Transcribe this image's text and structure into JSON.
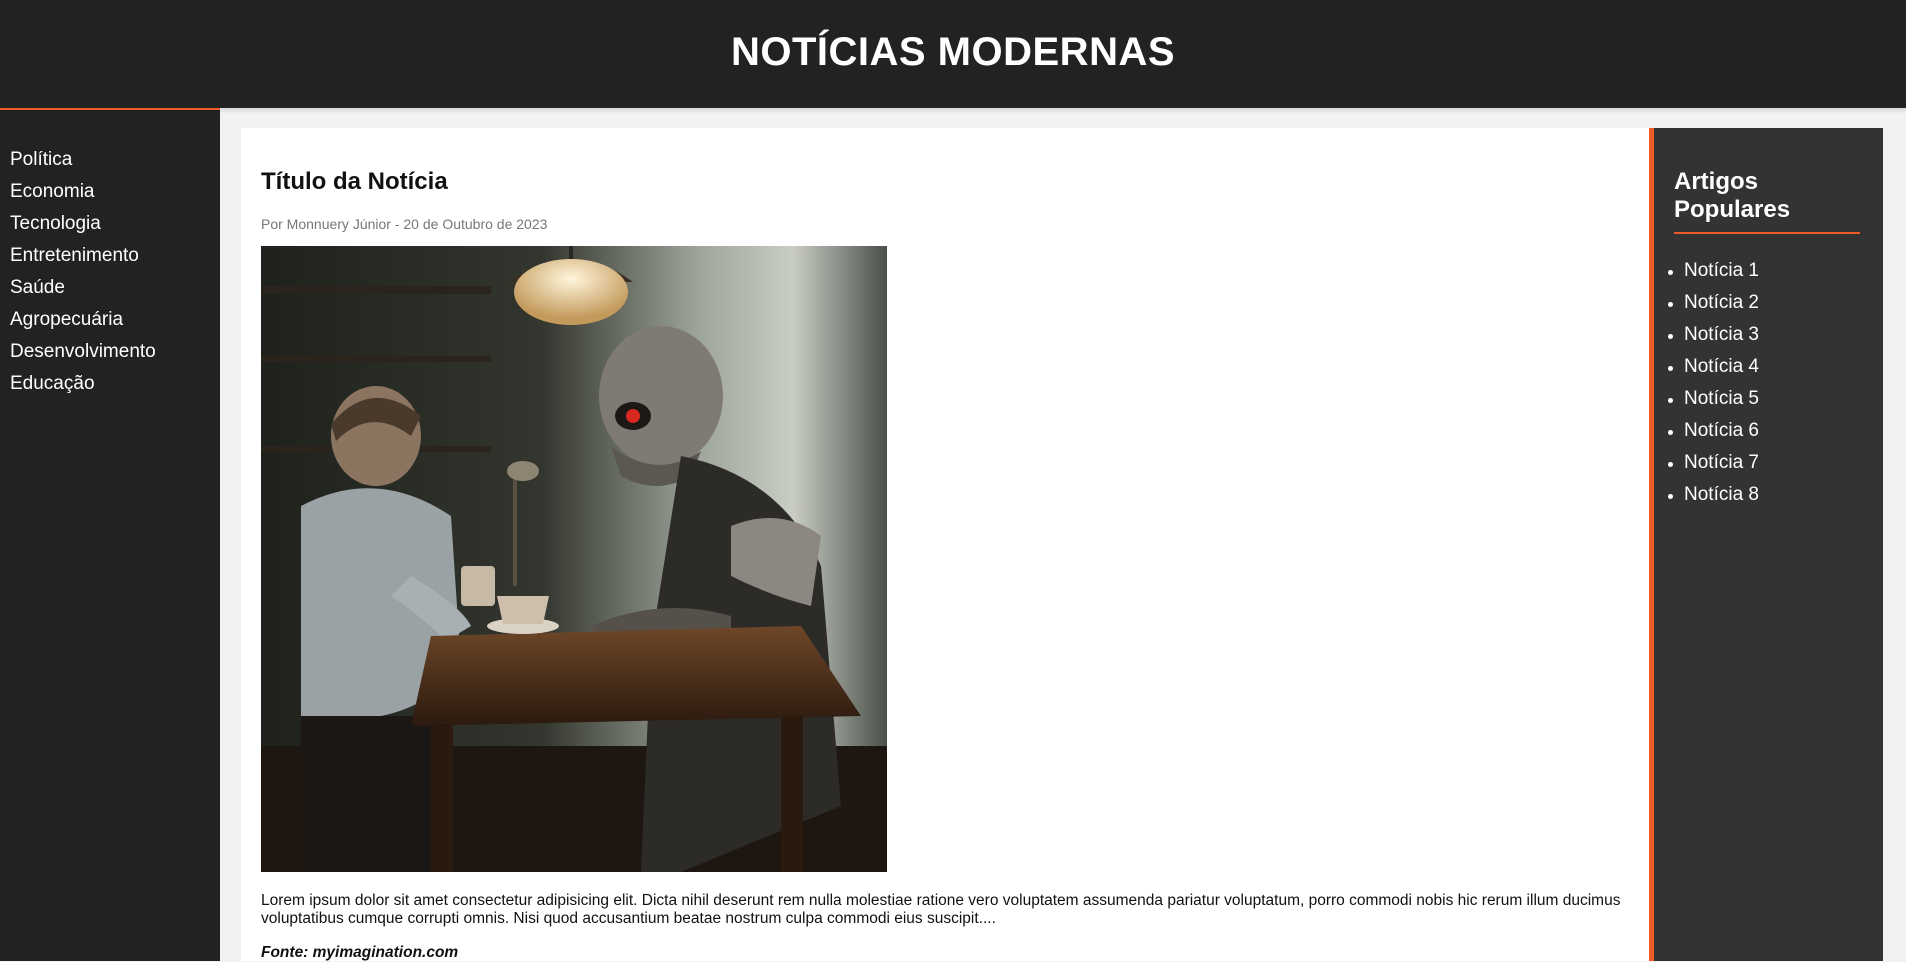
{
  "header": {
    "title": "NOTÍCIAS MODERNAS"
  },
  "sidebar": {
    "items": [
      {
        "label": "Política"
      },
      {
        "label": "Economia"
      },
      {
        "label": "Tecnologia"
      },
      {
        "label": "Entretenimento"
      },
      {
        "label": "Saúde"
      },
      {
        "label": "Agropecuária"
      },
      {
        "label": "Desenvolvimento"
      },
      {
        "label": "Educação"
      }
    ]
  },
  "article": {
    "title": "Título da Notícia",
    "meta": "Por Monnuery Júnior - 20 de Outubro de 2023",
    "body": "Lorem ipsum dolor sit amet consectetur adipisicing elit. Dicta nihil deserunt rem nulla molestiae ratione vero voluptatem assumenda pariatur voluptatum, porro commodi nobis hic rerum illum ducimus voluptatibus cumque corrupti omnis. Nisi quod accusantium beatae nostrum culpa commodi eius suscipit....",
    "source": "Fonte: myimagination.com"
  },
  "popular": {
    "title": "Artigos Populares",
    "items": [
      {
        "label": "Notícia 1"
      },
      {
        "label": "Notícia 2"
      },
      {
        "label": "Notícia 3"
      },
      {
        "label": "Notícia 4"
      },
      {
        "label": "Notícia 5"
      },
      {
        "label": "Notícia 6"
      },
      {
        "label": "Notícia 7"
      },
      {
        "label": "Notícia 8"
      }
    ]
  },
  "colors": {
    "dark": "#222222",
    "panel": "#333333",
    "accent": "#f05a28"
  }
}
